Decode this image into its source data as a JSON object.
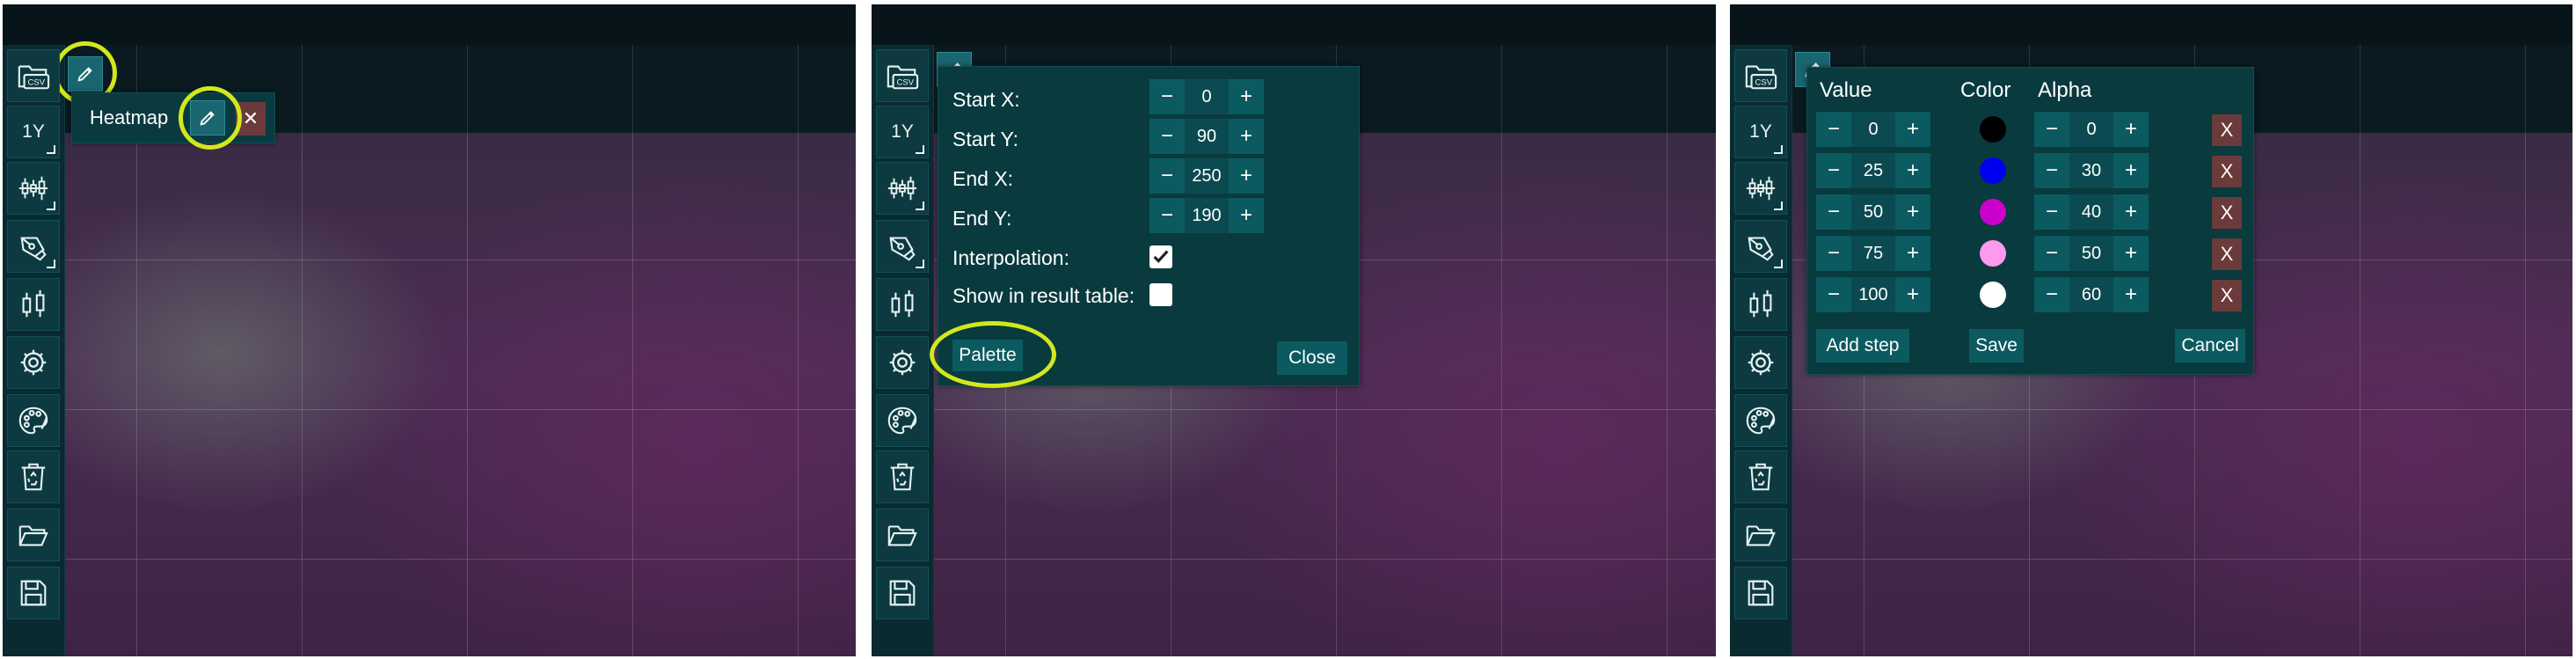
{
  "toolbar": {
    "items": [
      {
        "icon": "csv-folder-icon",
        "text": "CSV"
      },
      {
        "icon": "timeframe-icon",
        "text": "1Y"
      },
      {
        "icon": "candlestick-chart-icon",
        "text": ""
      },
      {
        "icon": "pen-tool-icon",
        "text": ""
      },
      {
        "icon": "indicator-icon",
        "text": ""
      },
      {
        "icon": "gear-icon",
        "text": ""
      },
      {
        "icon": "palette-icon",
        "text": ""
      },
      {
        "icon": "recycle-bin-icon",
        "text": ""
      },
      {
        "icon": "open-folder-icon",
        "text": ""
      },
      {
        "icon": "save-disk-icon",
        "text": ""
      }
    ]
  },
  "panel1": {
    "heatmap_label": "Heatmap",
    "close_symbol": "✕"
  },
  "panel2": {
    "fields": [
      {
        "label": "Start X:",
        "value": "0"
      },
      {
        "label": "Start Y:",
        "value": "90"
      },
      {
        "label": "End X:",
        "value": "250"
      },
      {
        "label": "End Y:",
        "value": "190"
      }
    ],
    "interpolation_label": "Interpolation:",
    "interpolation_checked": true,
    "show_table_label": "Show in result table:",
    "show_table_checked": false,
    "palette_button": "Palette",
    "close_button": "Close"
  },
  "panel3": {
    "headers": {
      "value": "Value",
      "color": "Color",
      "alpha": "Alpha"
    },
    "steps": [
      {
        "value": "0",
        "color": "#000000",
        "alpha": "0"
      },
      {
        "value": "25",
        "color": "#0000ee",
        "alpha": "30"
      },
      {
        "value": "50",
        "color": "#cc00cc",
        "alpha": "40"
      },
      {
        "value": "75",
        "color": "#ff99ee",
        "alpha": "50"
      },
      {
        "value": "100",
        "color": "#ffffff",
        "alpha": "60"
      }
    ],
    "remove_symbol": "X",
    "add_step_button": "Add step",
    "save_button": "Save",
    "cancel_button": "Cancel"
  },
  "stepper": {
    "minus": "−",
    "plus": "+"
  },
  "colors": {
    "accent_highlight": "#d2e81d",
    "popup_bg": "#083a3e",
    "button_bg": "#0b5a60",
    "delete_bg": "#6b3a3a"
  }
}
